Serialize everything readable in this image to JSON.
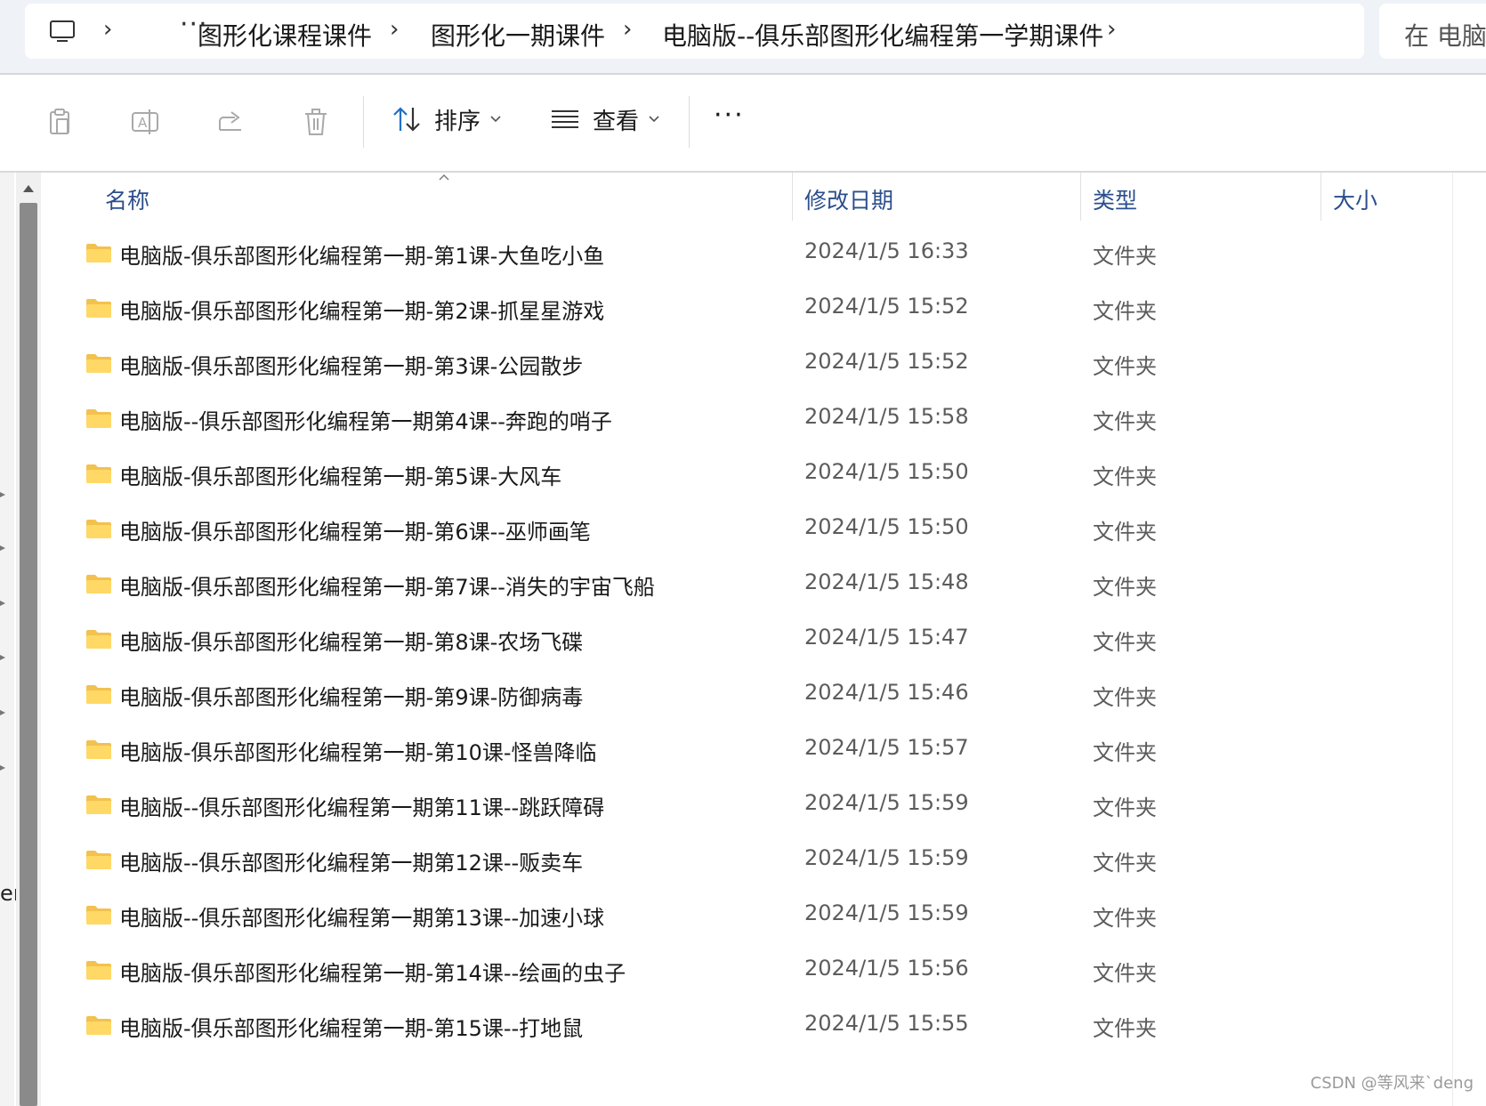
{
  "breadcrumb": {
    "more": "···",
    "items": [
      "图形化课程课件",
      "图形化一期课件",
      "电脑版--俱乐部图形化编程第一学期课件"
    ],
    "separator": "›",
    "search_placeholder": "在 电脑"
  },
  "toolbar": {
    "sort_label": "排序",
    "view_label": "查看",
    "more_label": "···"
  },
  "nav_stub_text": "er",
  "columns": {
    "name": "名称",
    "date": "修改日期",
    "type": "类型",
    "size": "大小"
  },
  "files": [
    {
      "name": "电脑版-俱乐部图形化编程第一期-第1课-大鱼吃小鱼",
      "date": "2024/1/5 16:33",
      "type": "文件夹"
    },
    {
      "name": "电脑版-俱乐部图形化编程第一期-第2课-抓星星游戏",
      "date": "2024/1/5 15:52",
      "type": "文件夹"
    },
    {
      "name": "电脑版-俱乐部图形化编程第一期-第3课-公园散步",
      "date": "2024/1/5 15:52",
      "type": "文件夹"
    },
    {
      "name": "电脑版--俱乐部图形化编程第一期第4课--奔跑的哨子",
      "date": "2024/1/5 15:58",
      "type": "文件夹"
    },
    {
      "name": "电脑版-俱乐部图形化编程第一期-第5课-大风车",
      "date": "2024/1/5 15:50",
      "type": "文件夹"
    },
    {
      "name": "电脑版-俱乐部图形化编程第一期-第6课--巫师画笔",
      "date": "2024/1/5 15:50",
      "type": "文件夹"
    },
    {
      "name": "电脑版-俱乐部图形化编程第一期-第7课--消失的宇宙飞船",
      "date": "2024/1/5 15:48",
      "type": "文件夹"
    },
    {
      "name": "电脑版-俱乐部图形化编程第一期-第8课-农场飞碟",
      "date": "2024/1/5 15:47",
      "type": "文件夹"
    },
    {
      "name": "电脑版-俱乐部图形化编程第一期-第9课-防御病毒",
      "date": "2024/1/5 15:46",
      "type": "文件夹"
    },
    {
      "name": "电脑版-俱乐部图形化编程第一期-第10课-怪兽降临",
      "date": "2024/1/5 15:57",
      "type": "文件夹"
    },
    {
      "name": "电脑版--俱乐部图形化编程第一期第11课--跳跃障碍",
      "date": "2024/1/5 15:59",
      "type": "文件夹"
    },
    {
      "name": "电脑版--俱乐部图形化编程第一期第12课--贩卖车",
      "date": "2024/1/5 15:59",
      "type": "文件夹"
    },
    {
      "name": "电脑版--俱乐部图形化编程第一期第13课--加速小球",
      "date": "2024/1/5 15:59",
      "type": "文件夹"
    },
    {
      "name": "电脑版-俱乐部图形化编程第一期-第14课--绘画的虫子",
      "date": "2024/1/5 15:56",
      "type": "文件夹"
    },
    {
      "name": "电脑版-俱乐部图形化编程第一期-第15课--打地鼠",
      "date": "2024/1/5 15:55",
      "type": "文件夹"
    }
  ],
  "watermark": "CSDN @等风来`deng",
  "colors": {
    "header_text": "#2b4e8c",
    "folder": "#f2c14e",
    "accent": "#1f6fc7"
  }
}
